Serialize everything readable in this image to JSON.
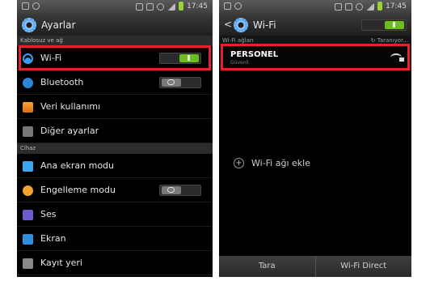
{
  "left": {
    "status": {
      "time": "17:45"
    },
    "title": "Ayarlar",
    "section_wireless": "Kablosuz ve ağ",
    "items": [
      {
        "label": "Wi-Fi",
        "icon": "wifi-icon",
        "toggle": "on"
      },
      {
        "label": "Bluetooth",
        "icon": "bluetooth-icon",
        "toggle": "off"
      },
      {
        "label": "Veri kullanımı",
        "icon": "data-usage-icon"
      },
      {
        "label": "Diğer ayarlar",
        "icon": "more-settings-icon"
      }
    ],
    "section_device": "Cihaz",
    "device_items": [
      {
        "label": "Ana ekran modu",
        "icon": "home-screen-icon"
      },
      {
        "label": "Engelleme modu",
        "icon": "blocking-mode-icon",
        "toggle": "off"
      },
      {
        "label": "Ses",
        "icon": "sound-icon"
      },
      {
        "label": "Ekran",
        "icon": "display-icon"
      },
      {
        "label": "Kayıt yeri",
        "icon": "storage-icon"
      }
    ]
  },
  "right": {
    "status": {
      "time": "17:45"
    },
    "title": "Wi-Fi",
    "networks_header": "Wi-Fi ağları",
    "scanning": "Taranıyor...",
    "network": {
      "name": "PERSONEL",
      "status": "Güvenli"
    },
    "add_network": "Wi-Fi ağı ekle",
    "bottom": {
      "scan": "Tara",
      "direct": "Wi-Fi Direct"
    }
  },
  "colors": {
    "highlight": "#e8202a",
    "toggle_on": "#6cbe1e"
  }
}
